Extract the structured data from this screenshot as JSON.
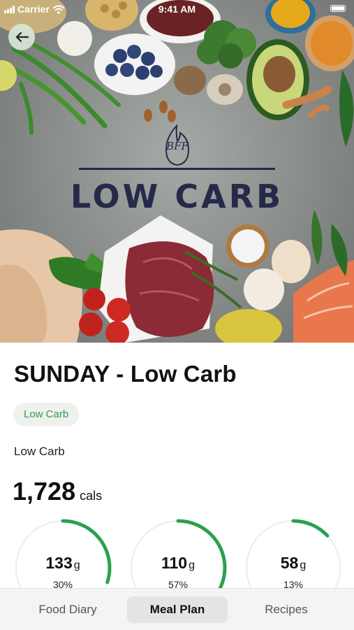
{
  "status_bar": {
    "carrier": "Carrier",
    "time": "9:41 AM"
  },
  "hero": {
    "logo_text": "BFF",
    "brand_title": "LOW CARB"
  },
  "icons": {
    "back": "back-arrow-icon",
    "wifi": "wifi-icon",
    "signal": "signal-icon",
    "battery": "battery-icon",
    "logo": "flame-logo-icon"
  },
  "plan": {
    "day_title": "SUNDAY - Low Carb",
    "tag": "Low Carb",
    "description": "Low Carb",
    "calories": {
      "value": "1,728",
      "unit": "cals"
    },
    "macros": [
      {
        "amount": "133",
        "unit": "g",
        "percent": "30%",
        "fraction": 0.3
      },
      {
        "amount": "110",
        "unit": "g",
        "percent": "57%",
        "fraction": 0.57
      },
      {
        "amount": "58",
        "unit": "g",
        "percent": "13%",
        "fraction": 0.13
      }
    ]
  },
  "tabs": [
    {
      "label": "Food Diary",
      "active": false
    },
    {
      "label": "Meal Plan",
      "active": true
    },
    {
      "label": "Recipes",
      "active": false
    }
  ],
  "colors": {
    "accent_green": "#2aa14c",
    "brand_navy": "#25294a",
    "ring_track": "#ececec"
  }
}
